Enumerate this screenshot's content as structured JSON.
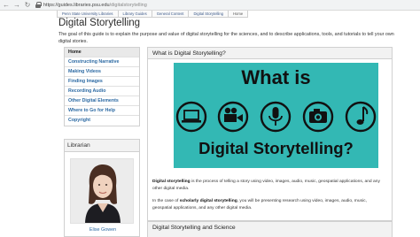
{
  "browser": {
    "url_domain": "https://guides.libraries.psu.edu",
    "url_path": "/digitalstorytelling"
  },
  "breadcrumbs": [
    "Penn State University Libraries",
    "Library Guides",
    "General Content",
    "Digital Storytelling",
    "Home"
  ],
  "page": {
    "title": "Digital Storytelling",
    "intro": "The goal of this guide is to explain the purpose and value of digital storytelling for the sciences, and to describe applications, tools, and tutorials to tell your own digital stories."
  },
  "nav": {
    "items": [
      {
        "label": "Home",
        "active": true
      },
      {
        "label": "Constructing Narrative"
      },
      {
        "label": "Making Videos"
      },
      {
        "label": "Finding Images"
      },
      {
        "label": "Recording Audio"
      },
      {
        "label": "Other Digital Elements"
      },
      {
        "label": "Where to Go for Help"
      },
      {
        "label": "Copyright"
      }
    ]
  },
  "librarian": {
    "heading": "Librarian",
    "name": "Elise Gowen"
  },
  "main": {
    "heading": "What is Digital Storytelling?",
    "hero_title_top": "What is",
    "hero_title_bottom": "Digital Storytelling?",
    "hero_icons": [
      "laptop-icon",
      "video-camera-icon",
      "microphone-icon",
      "camera-icon",
      "music-note-icon"
    ],
    "hero_bg": "#33b8b4",
    "para1_term": "Digital storytelling",
    "para1_rest": " is the process of telling a story using video, images, audio, music, geospatial applications, and any other digital media.",
    "para2_start": "In the case of ",
    "para2_term": "scholarly digital storytelling",
    "para2_rest": ", you will be presenting research using video, images, audio, music, geospatial applications, and any other digital media."
  },
  "section2": {
    "heading": "Digital Storytelling and Science"
  }
}
